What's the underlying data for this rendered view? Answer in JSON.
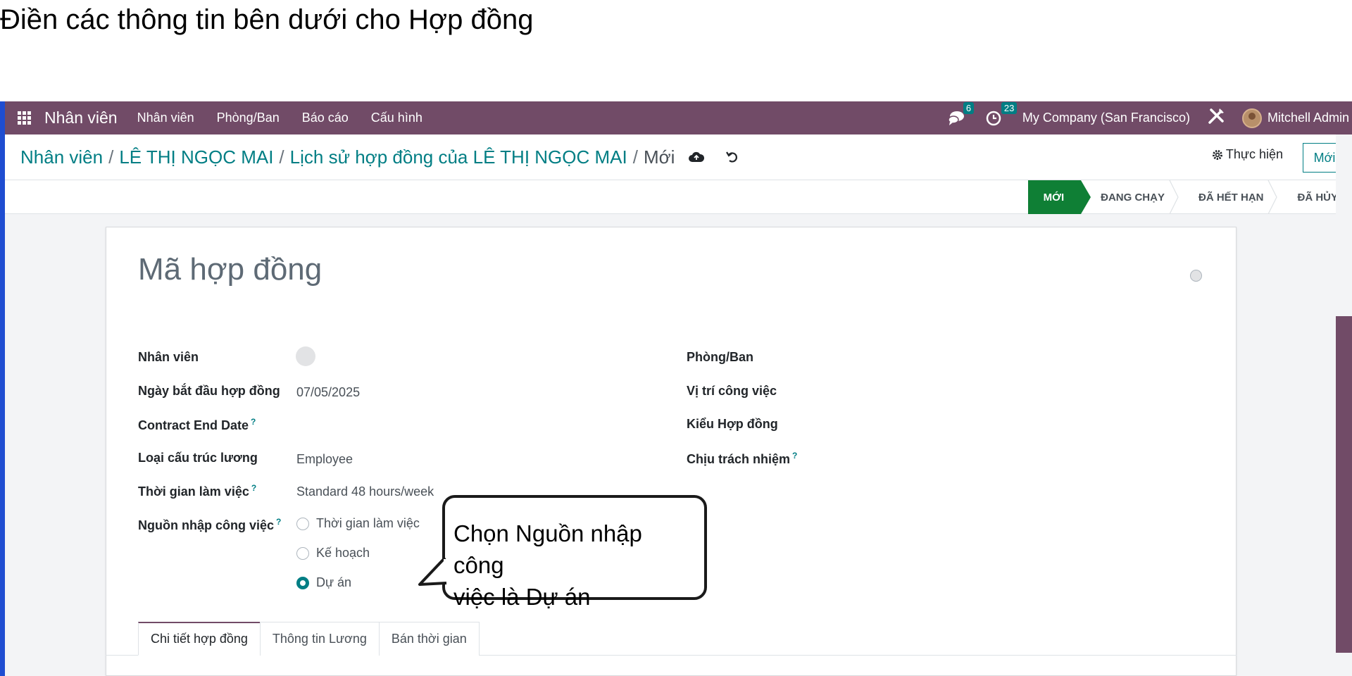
{
  "instruction": "Điền các thông tin  bên dưới cho Hợp đồng",
  "navbar": {
    "app_name": "Nhân viên",
    "menu": [
      "Nhân viên",
      "Phòng/Ban",
      "Báo cáo",
      "Cấu hình"
    ],
    "messages_count": "6",
    "activities_count": "23",
    "company": "My Company (San Francisco)",
    "user": "Mitchell Admin"
  },
  "breadcrumb": {
    "items": [
      "Nhân viên",
      "LÊ THỊ NGỌC MAI",
      "Lịch sử hợp đồng của LÊ THỊ NGỌC MAI"
    ],
    "current": "Mới",
    "separator": "/"
  },
  "control": {
    "action_label": "Thực hiện",
    "new_label": "Mới"
  },
  "stages": [
    "MỚI",
    "ĐANG CHẠY",
    "ĐÃ HẾT HẠN",
    "ĐÃ HỦY"
  ],
  "form": {
    "title_placeholder": "Mã hợp đồng",
    "left": {
      "employee_label": "Nhân viên",
      "start_date_label": "Ngày bắt đầu hợp đồng",
      "start_date_value": "07/05/2025",
      "end_date_label": "Contract End Date",
      "salary_structure_label": "Loại cấu trúc lương",
      "salary_structure_value": "Employee",
      "working_time_label": "Thời gian làm việc",
      "working_time_value": "Standard 48 hours/week",
      "work_entry_source_label": "Nguồn nhập công việc",
      "work_entry_options": [
        "Thời gian làm việc",
        "Kế hoạch",
        "Dự án"
      ],
      "work_entry_selected": "Dự án"
    },
    "right": {
      "department_label": "Phòng/Ban",
      "job_position_label": "Vị trí công việc",
      "contract_type_label": "Kiểu Hợp đồng",
      "responsible_label": "Chịu trách nhiệm"
    },
    "help_mark": "?"
  },
  "callout": {
    "line1": "Chọn Nguồn nhập công",
    "line2": "việc là Dự án"
  },
  "tabs": [
    "Chi tiết hợp đồng",
    "Thông tin Lương",
    "Bán thời gian"
  ],
  "colors": {
    "brand": "#714b67",
    "accent": "#017e84",
    "stage_active": "#0f7f35"
  }
}
